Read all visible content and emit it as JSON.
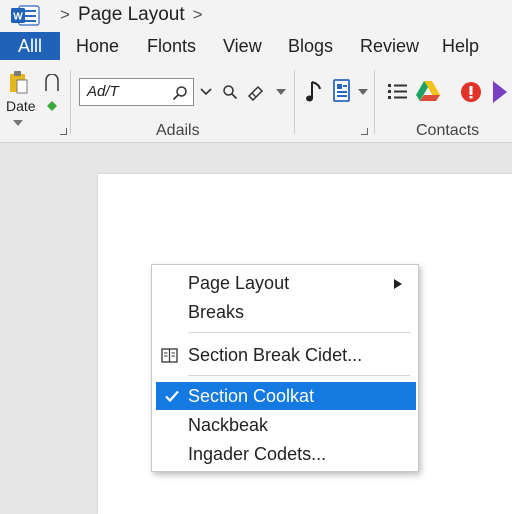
{
  "titlebar": {
    "app_icon": "word-icon",
    "breadcrumb_current": "Page Layout"
  },
  "tabs": {
    "all": "Alll",
    "items": [
      "Hone",
      "Flonts",
      "View",
      "Blogs",
      "Review",
      "Help"
    ]
  },
  "ribbon": {
    "date_label": "Date",
    "font_combo_value": "Ad/T",
    "group_label_1": "Adails",
    "group_label_2": "Contacts",
    "icons": [
      "paste-icon",
      "notch-icon",
      "search-icon",
      "chevron-down-icon",
      "zoom-icon",
      "link-icon",
      "dropdown-arrow-icon",
      "music-note-icon",
      "document-icon",
      "list-icon",
      "drive-icon",
      "stop-icon",
      "nexus-icon"
    ]
  },
  "menu": {
    "items": [
      {
        "label": "Page Layout",
        "has_submenu": true
      },
      {
        "label": "Breaks"
      },
      {
        "label": "Section Break Cidet...",
        "icon": "section-icon"
      },
      {
        "label": "Section Coolkat",
        "checked": true,
        "selected": true
      },
      {
        "label": "Nackbeak"
      },
      {
        "label": "Ingader Codets..."
      }
    ]
  },
  "colors": {
    "accent": "#1f62b8",
    "selection": "#1479e0"
  }
}
